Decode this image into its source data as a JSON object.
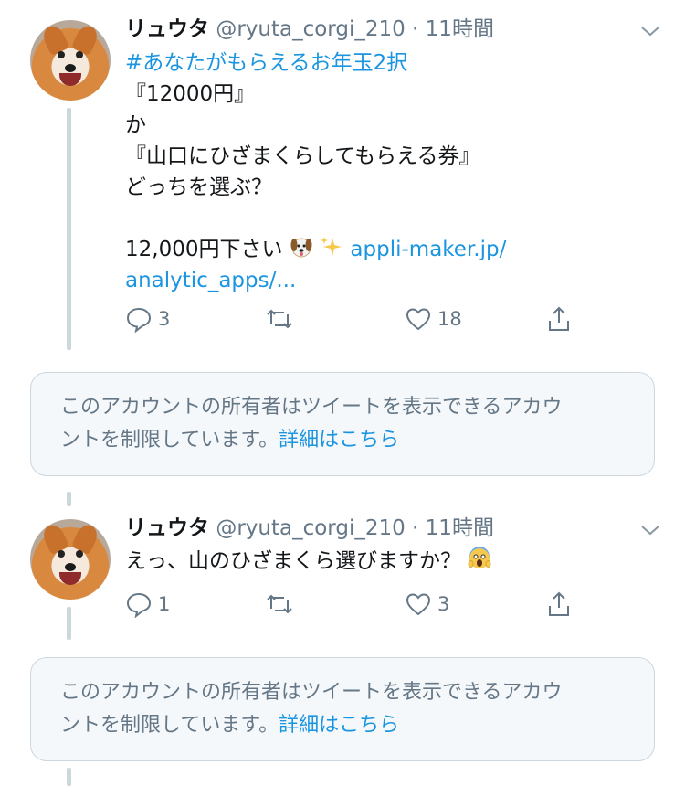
{
  "tweets": [
    {
      "name": "リュウタ",
      "handle": "@ryuta_corgi_210",
      "dot": "·",
      "time": "11時間",
      "hashtag": "#あなたがもらえるお年玉2択",
      "lines": [
        "『12000円』",
        "か",
        "『山口にひざまくらしてもらえる券』",
        "どっちを選ぶ？"
      ],
      "answer": "12,000円下さい",
      "link_1": "appli-maker.jp/",
      "link_2": "analytic_apps/...",
      "replies": "3",
      "likes": "18"
    },
    {
      "name": "リュウタ",
      "handle": "@ryuta_corgi_210",
      "dot": "·",
      "time": "11時間",
      "text": "えっ、山のひざまくら選びますか？",
      "replies": "1",
      "likes": "3"
    }
  ],
  "notices": [
    {
      "line1": "このアカウントの所有者はツイートを表示できるアカウ",
      "line2": "ントを制限しています。",
      "more": "詳細はこちら"
    },
    {
      "line1": "このアカウントの所有者はツイートを表示できるアカウ",
      "line2": "ントを制限しています。",
      "more": "詳細はこちら"
    }
  ],
  "icons": {
    "reply": "reply-icon",
    "retweet": "retweet-icon",
    "like": "heart-icon",
    "share": "share-icon",
    "menu": "chevron-down-icon"
  },
  "colors": {
    "link": "#1b95e0",
    "muted": "#657786",
    "thread": "#ccd6dd"
  }
}
